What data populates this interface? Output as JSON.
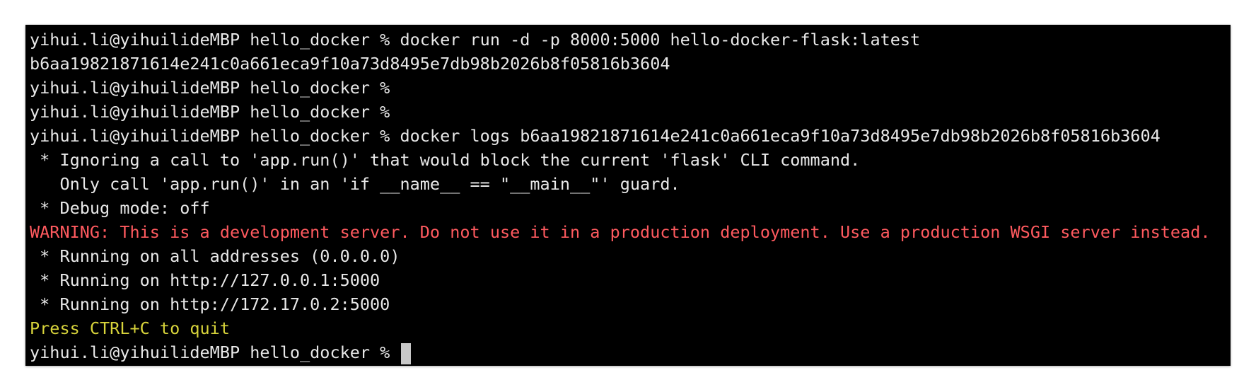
{
  "terminal": {
    "lines": [
      {
        "text": "yihui.li@yihuilideMBP hello_docker % docker run -d -p 8000:5000 hello-docker-flask:latest",
        "kind": "normal"
      },
      {
        "text": "b6aa19821871614e241c0a661eca9f10a73d8495e7db98b2026b8f05816b3604",
        "kind": "normal"
      },
      {
        "text": "yihui.li@yihuilideMBP hello_docker %",
        "kind": "normal"
      },
      {
        "text": "yihui.li@yihuilideMBP hello_docker %",
        "kind": "normal"
      },
      {
        "text": "yihui.li@yihuilideMBP hello_docker % docker logs b6aa19821871614e241c0a661eca9f10a73d8495e7db98b2026b8f05816b3604",
        "kind": "normal"
      },
      {
        "text": " * Ignoring a call to 'app.run()' that would block the current 'flask' CLI command.",
        "kind": "normal"
      },
      {
        "text": "   Only call 'app.run()' in an 'if __name__ == \"__main__\"' guard.",
        "kind": "normal"
      },
      {
        "text": " * Debug mode: off",
        "kind": "normal"
      },
      {
        "text": "WARNING: This is a development server. Do not use it in a production deployment. Use a production WSGI server instead.",
        "kind": "warning"
      },
      {
        "text": " * Running on all addresses (0.0.0.0)",
        "kind": "normal"
      },
      {
        "text": " * Running on http://127.0.0.1:5000",
        "kind": "normal"
      },
      {
        "text": " * Running on http://172.17.0.2:5000",
        "kind": "normal"
      },
      {
        "text": "Press CTRL+C to quit",
        "kind": "notice"
      }
    ],
    "prompt": "yihui.li@yihuilideMBP hello_docker % ",
    "colors": {
      "background": "#000000",
      "text": "#e8e8e8",
      "warning": "#ff5a5f",
      "notice": "#d8d43b",
      "cursor": "#c8c8c8"
    }
  }
}
